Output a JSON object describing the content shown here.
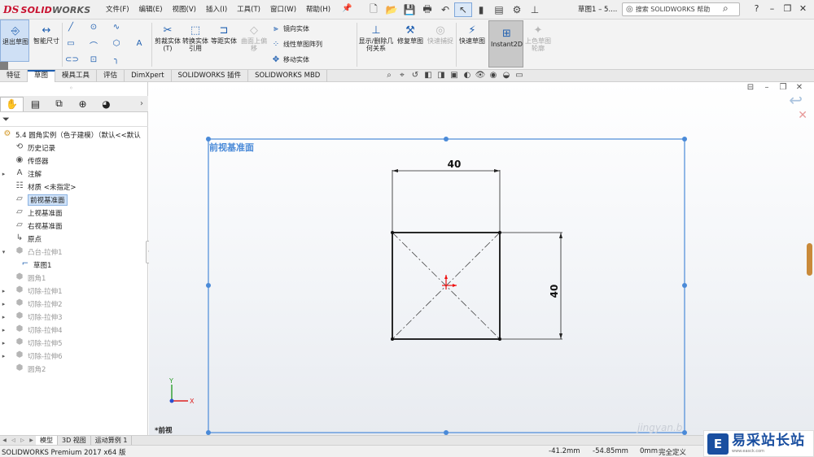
{
  "app": {
    "logo_prefix": "DS",
    "logo_s": "SOLID",
    "logo_w": "WORKS",
    "doc_title": "草图1 – 5....",
    "help_placeholder": "搜索 SOLIDWORKS 帮助"
  },
  "menu": [
    "文件(F)",
    "编辑(E)",
    "视图(V)",
    "插入(I)",
    "工具(T)",
    "窗口(W)",
    "帮助(H)"
  ],
  "ribbon": {
    "exit_sketch": "退出草图",
    "smart_dim": "智能尺寸",
    "trim": "剪裁实体(T)",
    "convert": "转换实体引用",
    "offset": "等距实体",
    "surface_offset": "曲面上偏移",
    "mirror": "镜向实体",
    "linear_pattern": "线性草图阵列",
    "move": "移动实体",
    "show_relations": "显示/删除几何关系",
    "repair": "修复草图",
    "quick_snaps": "快速捕捉",
    "rapid_sketch": "快速草图",
    "instant2d": "Instant2D",
    "shaded_contours": "上色草图轮廓"
  },
  "tabs": [
    {
      "label": "特征",
      "active": false
    },
    {
      "label": "草图",
      "active": true
    },
    {
      "label": "模具工具",
      "active": false
    },
    {
      "label": "评估",
      "active": false
    },
    {
      "label": "DimXpert",
      "active": false
    },
    {
      "label": "SOLIDWORKS 插件",
      "active": false
    },
    {
      "label": "SOLIDWORKS MBD",
      "active": false
    }
  ],
  "tree": {
    "root": "5.4 圆角实例（色子建模）（默认<<默认",
    "history": "历史记录",
    "sensors": "传感器",
    "annotations": "注解",
    "material": "材质 <未指定>",
    "front_plane": "前视基准面",
    "top_plane": "上视基准面",
    "right_plane": "右视基准面",
    "origin": "原点",
    "boss_extrude": "凸台-拉伸1",
    "sketch1": "草图1",
    "fillet1": "圆角1",
    "cut1": "切除-拉伸1",
    "cut2": "切除-拉伸2",
    "cut3": "切除-拉伸3",
    "cut4": "切除-拉伸4",
    "cut5": "切除-拉伸5",
    "cut6": "切除-拉伸6",
    "fillet2": "圆角2"
  },
  "graphics": {
    "plane_label": "前视基准面",
    "view_label": "*前视",
    "dim_horizontal": "40",
    "dim_vertical": "40",
    "triad_x": "X",
    "triad_y": "Y",
    "watermark": "jingyan.b"
  },
  "model_tabs": [
    {
      "label": "模型",
      "active": true
    },
    {
      "label": "3D 视图",
      "active": false
    },
    {
      "label": "运动算例 1",
      "active": false
    }
  ],
  "status": {
    "product": "SOLIDWORKS Premium 2017 x64 版",
    "x": "-41.2mm",
    "y": "-54.85mm",
    "z": "0mm",
    "state": "完全定义"
  },
  "brand": {
    "logo": "E",
    "name": "易采站长站",
    "url": "www.easck.com"
  },
  "colors": {
    "accent": "#1f5fb0",
    "plane_border": "#4a8ad8",
    "sketch_line": "#111111",
    "brand": "#1a4fa0"
  }
}
